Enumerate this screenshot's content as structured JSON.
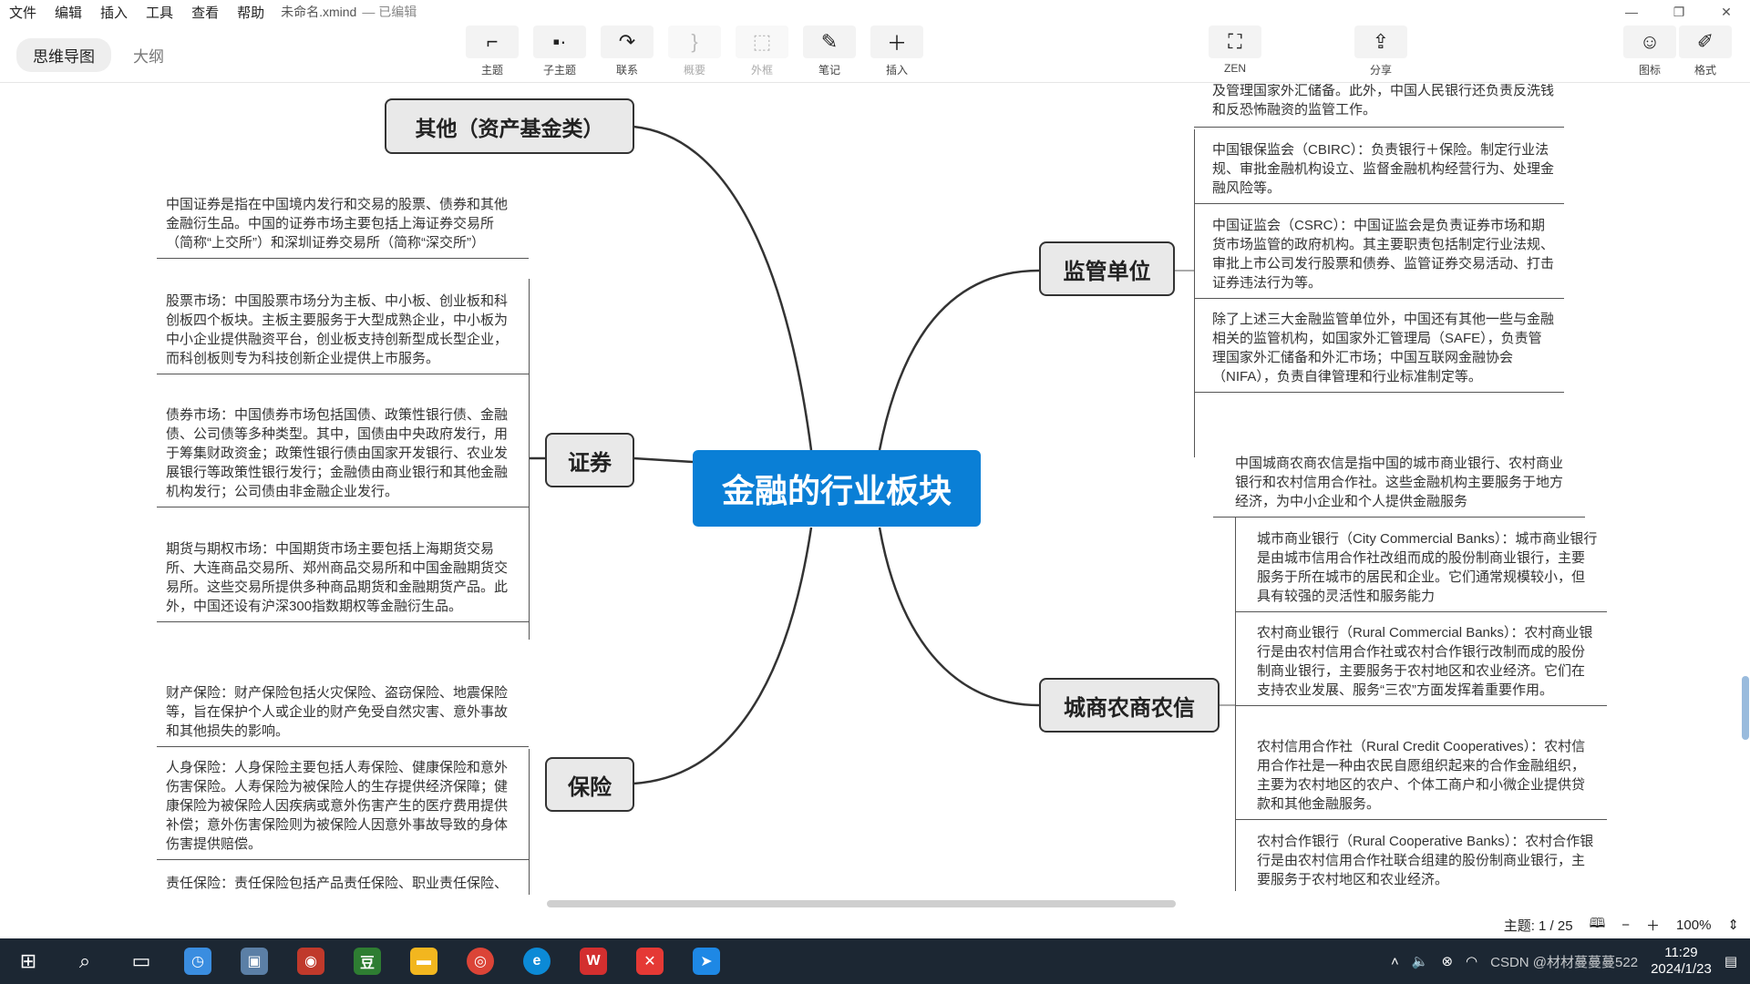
{
  "menu": [
    "文件",
    "编辑",
    "插入",
    "工具",
    "查看",
    "帮助"
  ],
  "doc": {
    "filename": "未命名.xmind",
    "status": "— 已编辑"
  },
  "window_controls": [
    "—",
    "❐",
    "✕"
  ],
  "view_tabs": {
    "mindmap": "思维导图",
    "outline": "大纲"
  },
  "toolbar": {
    "topic": "主题",
    "subtopic": "子主题",
    "relation": "联系",
    "summary": "概要",
    "boundary": "外框",
    "note": "笔记",
    "insert": "插入",
    "zen": "ZEN",
    "share": "分享",
    "icon": "图标",
    "format": "格式"
  },
  "central": "金融的行业板块",
  "branches": {
    "other": "其他（资产基金类）",
    "securities": "证券",
    "insurance": "保险",
    "regulator": "监管单位",
    "city_rural": "城商农商农信"
  },
  "notes": {
    "sec_intro": "中国证券是指在中国境内发行和交易的股票、债券和其他金融衍生品。中国的证券市场主要包括上海证券交易所（简称“上交所”）和深圳证券交易所（简称“深交所”）",
    "sec_stock": "股票市场：中国股票市场分为主板、中小板、创业板和科创板四个板块。主板主要服务于大型成熟企业，中小板为中小企业提供融资平台，创业板支持创新型成长型企业，而科创板则专为科技创新企业提供上市服务。",
    "sec_bond": "债券市场：中国债券市场包括国债、政策性银行债、金融债、公司债等多种类型。其中，国债由中央政府发行，用于筹集财政资金；政策性银行债由国家开发银行、农业发展银行等政策性银行发行；金融债由商业银行和其他金融机构发行；公司债由非金融企业发行。",
    "sec_futures": "期货与期权市场：中国期货市场主要包括上海期货交易所、大连商品交易所、郑州商品交易所和中国金融期货交易所。这些交易所提供多种商品期货和金融期货产品。此外，中国还设有沪深300指数期权等金融衍生品。",
    "ins_property": "财产保险：财产保险包括火灾保险、盗窃保险、地震保险等，旨在保护个人或企业的财产免受自然灾害、意外事故和其他损失的影响。",
    "ins_life": "人身保险：人身保险主要包括人寿保险、健康保险和意外伤害保险。人寿保险为被保险人的生存提供经济保障；健康保险为被保险人因疾病或意外伤害产生的医疗费用提供补偿；意外伤害保险则为被保险人因意外事故导致的身体伤害提供赔偿。",
    "ins_liability": "责任保险：责任保险包括产品责任保险、职业责任保险、",
    "reg_top": "及管理国家外汇储备。此外，中国人民银行还负责反洗钱和反恐怖融资的监管工作。",
    "reg_cbirc": "中国银保监会（CBIRC）：负责银行＋保险。制定行业法规、审批金融机构设立、监督金融机构经营行为、处理金融风险等。",
    "reg_csrc": "中国证监会（CSRC）：中国证监会是负责证券市场和期货市场监管的政府机构。其主要职责包括制定行业法规、审批上市公司发行股票和债券、监管证券交易活动、打击证券违法行为等。",
    "reg_other": "除了上述三大金融监管单位外，中国还有其他一些与金融相关的监管机构，如国家外汇管理局（SAFE），负责管理国家外汇储备和外汇市场；中国互联网金融协会（NIFA），负责自律管理和行业标准制定等。",
    "cr_intro": "中国城商农商农信是指中国的城市商业银行、农村商业银行和农村信用合作社。这些金融机构主要服务于地方经济，为中小企业和个人提供金融服务",
    "cr_city": "城市商业银行（City Commercial Banks）：城市商业银行是由城市信用合作社改组而成的股份制商业银行，主要服务于所在城市的居民和企业。它们通常规模较小，但具有较强的灵活性和服务能力",
    "cr_rural_comm": "农村商业银行（Rural Commercial Banks）：农村商业银行是由农村信用合作社或农村合作银行改制而成的股份制商业银行，主要服务于农村地区和农业经济。它们在支持农业发展、服务“三农”方面发挥着重要作用。",
    "cr_rural_credit": "农村信用合作社（Rural Credit Cooperatives）：农村信用合作社是一种由农民自愿组织起来的合作金融组织，主要为农村地区的农户、个体工商户和小微企业提供贷款和其他金融服务。",
    "cr_rural_coop": "农村合作银行（Rural Cooperative Banks）：农村合作银行是由农村信用合作社联合组建的股份制商业银行，主要服务于农村地区和农业经济。"
  },
  "statusbar": {
    "topic_count": "主题: 1 / 25",
    "zoom": "100%"
  },
  "taskbar": {
    "time": "11:29",
    "date": "2024/1/23",
    "watermark": "CSDN @材材蔓蔓蔓522"
  },
  "colors": {
    "central": "#0a7fd6",
    "node_fill": "#e9e9e9",
    "taskbar": "#1c2733"
  }
}
